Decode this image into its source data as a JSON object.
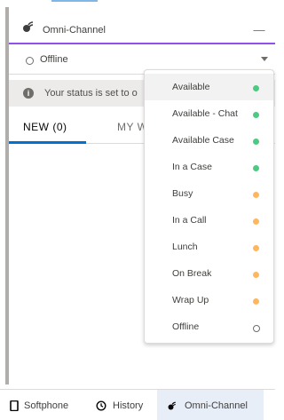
{
  "panel": {
    "title": "Omni-Channel",
    "minimize_glyph": "—",
    "status": "Offline",
    "notice": "Your status is set to o",
    "tabs": [
      {
        "label": "NEW (0)",
        "active": true
      },
      {
        "label": "MY W",
        "active": false
      }
    ]
  },
  "status_menu": {
    "items": [
      {
        "label": "Available",
        "state": "online",
        "selected": true
      },
      {
        "label": "Available - Chat",
        "state": "online",
        "selected": false
      },
      {
        "label": "Available Case",
        "state": "online",
        "selected": false
      },
      {
        "label": "In a Case",
        "state": "online",
        "selected": false
      },
      {
        "label": "Busy",
        "state": "busy",
        "selected": false
      },
      {
        "label": "In a Call",
        "state": "busy",
        "selected": false
      },
      {
        "label": "Lunch",
        "state": "busy",
        "selected": false
      },
      {
        "label": "On Break",
        "state": "busy",
        "selected": false
      },
      {
        "label": "Wrap Up",
        "state": "busy",
        "selected": false
      },
      {
        "label": "Offline",
        "state": "offline",
        "selected": false
      }
    ]
  },
  "footer": {
    "softphone": {
      "label": "Softphone",
      "icon": "phone-icon"
    },
    "history": {
      "label": "History",
      "icon": "clock-icon"
    },
    "omni": {
      "label": "Omni-Channel",
      "icon": "omni-channel-icon",
      "active": true
    }
  },
  "colors": {
    "online": "#4bca81",
    "busy": "#ffb75d",
    "accent": "#9050e9",
    "tab_underline": "#0070d2"
  }
}
